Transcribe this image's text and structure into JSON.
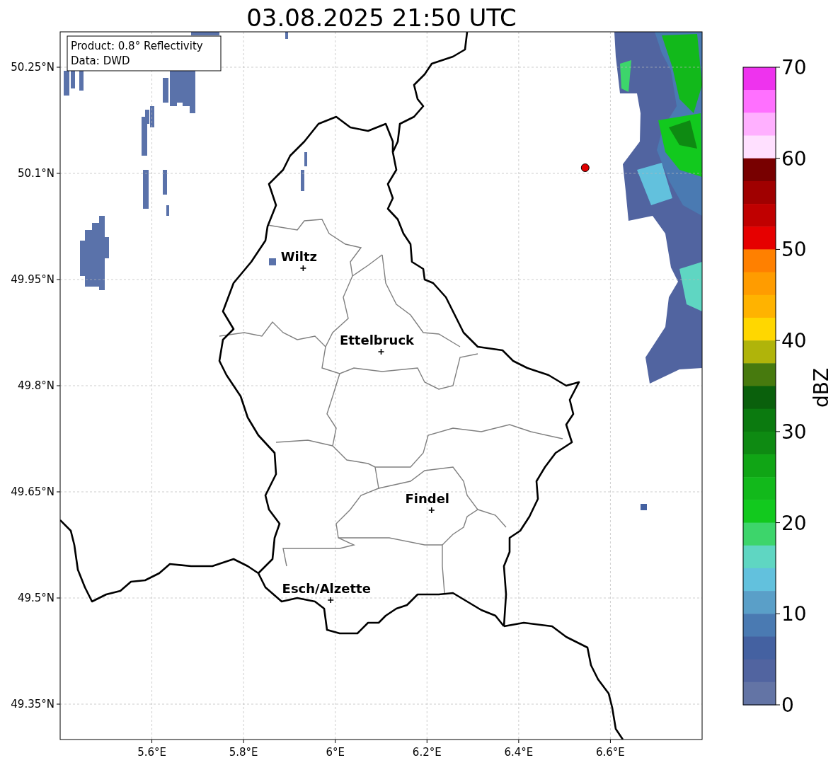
{
  "title": "03.08.2025 21:50 UTC",
  "info_box": [
    "Product: 0.8° Reflectivity",
    "Data: DWD"
  ],
  "map": {
    "grid": true,
    "lon_labels": [
      "5.6°E",
      "5.8°E",
      "6°E",
      "6.2°E",
      "6.4°E",
      "6.6°E"
    ],
    "lat_labels": [
      "50.25°N",
      "50.1°N",
      "49.95°N",
      "49.8°N",
      "49.65°N",
      "49.5°N",
      "49.35°N"
    ],
    "cities": [
      {
        "name": "Wiltz"
      },
      {
        "name": "Ettelbruck"
      },
      {
        "name": "Findel"
      },
      {
        "name": "Esch/Alzette"
      }
    ],
    "radar_site": {
      "shown": true
    }
  },
  "colorbar": {
    "label": "dBZ",
    "ticks": [
      "70",
      "60",
      "50",
      "40",
      "30",
      "20",
      "10",
      "0"
    ],
    "steps": [
      {
        "color": "#ee33ee"
      },
      {
        "color": "#ff70ff"
      },
      {
        "color": "#ffb0ff"
      },
      {
        "color": "#ffe0ff"
      },
      {
        "color": "#780000"
      },
      {
        "color": "#a00000"
      },
      {
        "color": "#c00000"
      },
      {
        "color": "#e60000"
      },
      {
        "color": "#ff8000"
      },
      {
        "color": "#ff9c00"
      },
      {
        "color": "#ffb300"
      },
      {
        "color": "#ffd700"
      },
      {
        "color": "#b0b40a"
      },
      {
        "color": "#477a0e"
      },
      {
        "color": "#0a600c"
      },
      {
        "color": "#0b7a0f"
      },
      {
        "color": "#0e8a12"
      },
      {
        "color": "#10a515"
      },
      {
        "color": "#12b91b"
      },
      {
        "color": "#12c91e"
      },
      {
        "color": "#3dd56b"
      },
      {
        "color": "#5fd6c2"
      },
      {
        "color": "#62c1dd"
      },
      {
        "color": "#5a9fc8"
      },
      {
        "color": "#4a7ab2"
      },
      {
        "color": "#4461a1"
      },
      {
        "color": "#5164a0"
      },
      {
        "color": "#6374a5"
      }
    ]
  }
}
